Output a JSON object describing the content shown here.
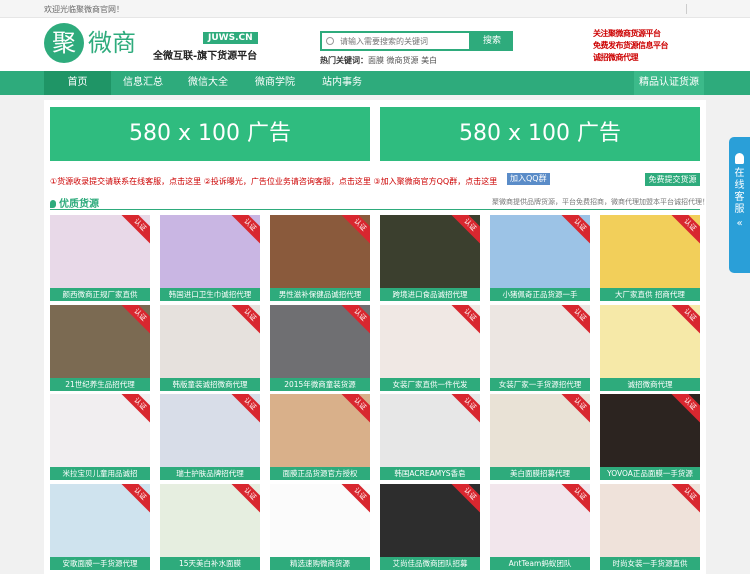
{
  "topbar": {
    "welcome": "欢迎光临聚微商官网！"
  },
  "header": {
    "logo_char": "聚",
    "logo_text": "微商",
    "domain": "JUWS.CN",
    "slogan": "全微互联-旗下货源平台",
    "search": {
      "placeholder": "请输入需要搜索的关键词",
      "button": "搜索"
    },
    "hot_words_label": "热门关键词：",
    "hot_words": "面膜 微商货源 美白",
    "promo_lines": [
      "关注聚微商货源平台",
      "免费发布货源信息平台",
      "诚招微商代理"
    ]
  },
  "nav": {
    "items": [
      "首页",
      "信息汇总",
      "微信大全",
      "微商学院",
      "站内事务"
    ],
    "cert": "精品认证货源"
  },
  "banners": [
    "580 x 100 广告",
    "580 x 100 广告"
  ],
  "notice": {
    "text": "①货源收录提交请联系在线客服，点击这里 ②投诉曝光，广告位业务请咨询客服，点击这里 ③加入聚微商官方QQ群，点击这里",
    "qq_button": "加入QQ群",
    "free_button": "免费提交货源"
  },
  "section": {
    "title": "优质货源",
    "note": "聚微商提供品牌货源，平台免费招商，微商代理加盟本平台诚招代理！"
  },
  "badge_label": "认证",
  "products": [
    {
      "caption": "颜西微商正规厂家直供",
      "color": "#e8d9e8"
    },
    {
      "caption": "韩国进口卫生巾诚招代理",
      "color": "#c9b6e3"
    },
    {
      "caption": "男性滋补保健品诚招代理",
      "color": "#8a5a3c"
    },
    {
      "caption": "跨境进口食品诚招代理",
      "color": "#3b3f2e"
    },
    {
      "caption": "小猪佩奇正品货源一手",
      "color": "#9cc3e6"
    },
    {
      "caption": "大厂家直供 招商代理",
      "color": "#f2cf5a"
    },
    {
      "caption": "21世纪养生品招代理",
      "color": "#7b6a52"
    },
    {
      "caption": "韩版童装诚招微商代理",
      "color": "#e6e1dd"
    },
    {
      "caption": "2015年微商童装货源",
      "color": "#6f6f72"
    },
    {
      "caption": "女装厂家直供一件代发",
      "color": "#f0e8e4"
    },
    {
      "caption": "女装厂家一手货源招代理",
      "color": "#ece6e2"
    },
    {
      "caption": "诚招微商代理",
      "color": "#f6e9a8"
    },
    {
      "caption": "米拉宝贝儿童用品诚招",
      "color": "#f1eef0"
    },
    {
      "caption": "瑞士护肤品牌招代理",
      "color": "#d8dde8"
    },
    {
      "caption": "面膜正品货源官方授权",
      "color": "#d9b08a"
    },
    {
      "caption": "韩国ACREAMYS香皂",
      "color": "#e7e7e7"
    },
    {
      "caption": "美白面膜招募代理",
      "color": "#e9e2d6"
    },
    {
      "caption": "YOVOA正品面膜一手货源",
      "color": "#2c2420"
    },
    {
      "caption": "安歌面膜一手货源代理",
      "color": "#cfe3ee"
    },
    {
      "caption": "15天美白补水面膜",
      "color": "#e6eee0"
    },
    {
      "caption": "精选速购微商货源",
      "color": "#fbfbfb"
    },
    {
      "caption": "艾尚佳品微商团队招募",
      "color": "#2d2d2d"
    },
    {
      "caption": "AntTeam蚂蚁团队",
      "color": "#f2e6ec"
    },
    {
      "caption": "时尚女装一手货源直供",
      "color": "#efe2da"
    }
  ],
  "float_service": {
    "label": "在线客服",
    "chevron": "«"
  }
}
